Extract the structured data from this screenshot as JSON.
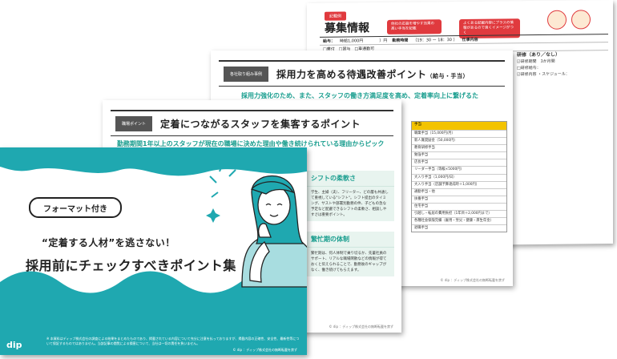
{
  "slide4": {
    "tag": "記載例",
    "title": "募集情報",
    "bubble_left": "他社の応募を増やす効果の高い手当を記載",
    "bubble_right": "よくある記載内容にプラスの情報があるので良くイメージがつく",
    "rows": [
      {
        "label": "給与：",
        "value": "時給1,000円　　　　）円"
      },
      {
        "label": "勤務時間",
        "value": "（19：30 ー 18：30 ）"
      },
      {
        "label": "仕事内容",
        "value": ""
      },
      {
        "label": "",
        "value": "□寮付　□賞与　□車通勤可"
      }
    ],
    "side_lines": [
      "研修（あり／なし）",
      "☑研修期間　3か月間",
      "□研修給与：",
      "☑研修内容 ・スケジュール："
    ]
  },
  "slide3": {
    "chip": "各社取り組み事例",
    "title": "採用力を高める待遇改善ポイント",
    "title_small": "（給与・手当）",
    "lead": "採用力強化のため、また、スタッフの働き方満足度を高め、定着率向上に繋げるため、給与・手当の見直しを実施しています。",
    "table_header": "手当",
    "table_rows": [
      "職業手当（15,000円/月）",
      "新人賞奨励金（50,000円）",
      "教育研修手当",
      "勉強手当",
      "店長手当",
      "リーダー手当（等級×5000円）",
      "大入り手当（1,000円/日）",
      "大入り手当（店舗予算達成時＋1,000円）",
      "通勤手当・他",
      "扶養手当",
      "住宅手当",
      "引越し・転居の費用負担（1年目＋2,000円まで）",
      "各種社会保険完備（雇用・労災・健康・厚生年金）",
      "退職手当"
    ],
    "footer": "© dip ：ディップ株式会社の無断転載を禁ず"
  },
  "slide2": {
    "chip": "職場ポイント",
    "title": "定着につながるスタッフを集客するポイント",
    "lead": "勤務期間1年以上のスタッフが現在の職場に決めた理由や働き続けられている理由からピックアップ。求職者に魅力をわかりやすく伝えていきましょう。",
    "card1_title": "シフトの柔軟さ",
    "card1_body": "学生、主婦（夫）、フリーター、どの層も共通して重視している\"シフト\"。シフト提出のタイミング、サストや部署別勤務の件、子どもの急な予定など配慮できるシフトの柔軟さ、相談しやすさは重要ポイント。",
    "card2_title": "繁忙期の体制",
    "card2_body": "繁忙期は、何人体制で乗り切るか、先輩社員のサポート、リアルな職場閑散などの情報が得ておくと伝えられることで、勤務後のギャップがなく、働き続けてもらえます。",
    "footer": "© dip ：ディップ株式会社の無断転載を禁ず"
  },
  "cover": {
    "badge": "フォーマット付き",
    "subtitle": "“定着する人材”を逃さない！",
    "title": "採用前にチェックすべきポイント集",
    "disclaimer": "※ 本資料はディップ株式会社の調査による結果をまとめたものであり、掲載されている内容について充分に注意を払っておりますが、掲載内容の正確性、安全性、最新性等について保証するものではありません。当該記事の閲覧による損害について、当社は一切の責任を負いません。",
    "logo": "dip",
    "copyright": "© dip ：ディップ株式会社の無断転載を禁ず",
    "colors": {
      "teal": "#1fa8b0",
      "dark": "#222222",
      "accent_red": "#e03a3e",
      "yellow": "#f3c300"
    }
  }
}
